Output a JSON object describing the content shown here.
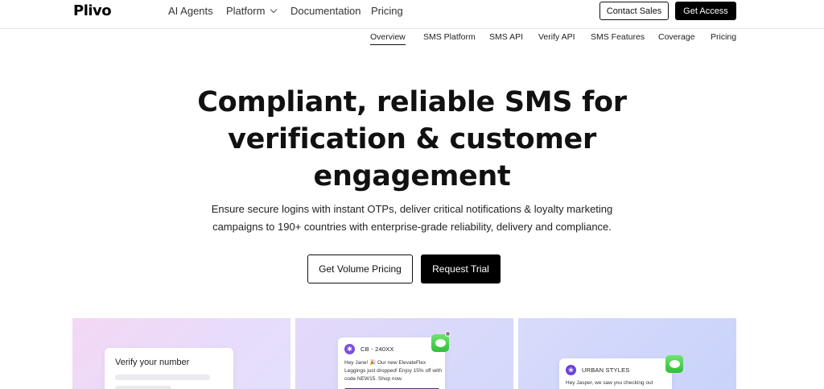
{
  "nav": {
    "logo": "Plivo",
    "links": [
      "AI Agents",
      "Platform",
      "Documentation",
      "Pricing"
    ],
    "contact_sales": "Contact Sales",
    "get_access": "Get Access"
  },
  "subnav": {
    "items": [
      "Overview",
      "SMS Platform",
      "SMS API",
      "Verify API",
      "SMS Features",
      "Coverage",
      "Pricing"
    ],
    "active": "Overview"
  },
  "hero": {
    "title_line1": "Compliant, reliable SMS for",
    "title_line2": "verification & customer",
    "title_line3": "engagement",
    "subtitle_line1": "Ensure secure logins with instant OTPs, deliver critical notifications & loyalty marketing",
    "subtitle_line2": "campaigns to 190+ countries with enterprise-grade reliability, delivery and compliance.",
    "btn_volume": "Get Volume Pricing",
    "btn_trial": "Request Trial"
  },
  "cards": {
    "verify_title": "Verify your number",
    "msg1_sender": "CB - 240XX",
    "msg1_avatar": "✱",
    "msg1_body": "Hey Jane! 🎉 Our new ElevateFlex Leggings just dropped! Enjoy 15% off with code NEW15. Shop now.",
    "msg2_sender": "URBAN STYLES",
    "msg2_avatar": "❀",
    "msg2_body": "Hey Jasper, we saw you checking out"
  },
  "colors": {
    "primary": "#000000",
    "accent_purple": "#7b4fe0",
    "imessage_green": "#34c759"
  }
}
